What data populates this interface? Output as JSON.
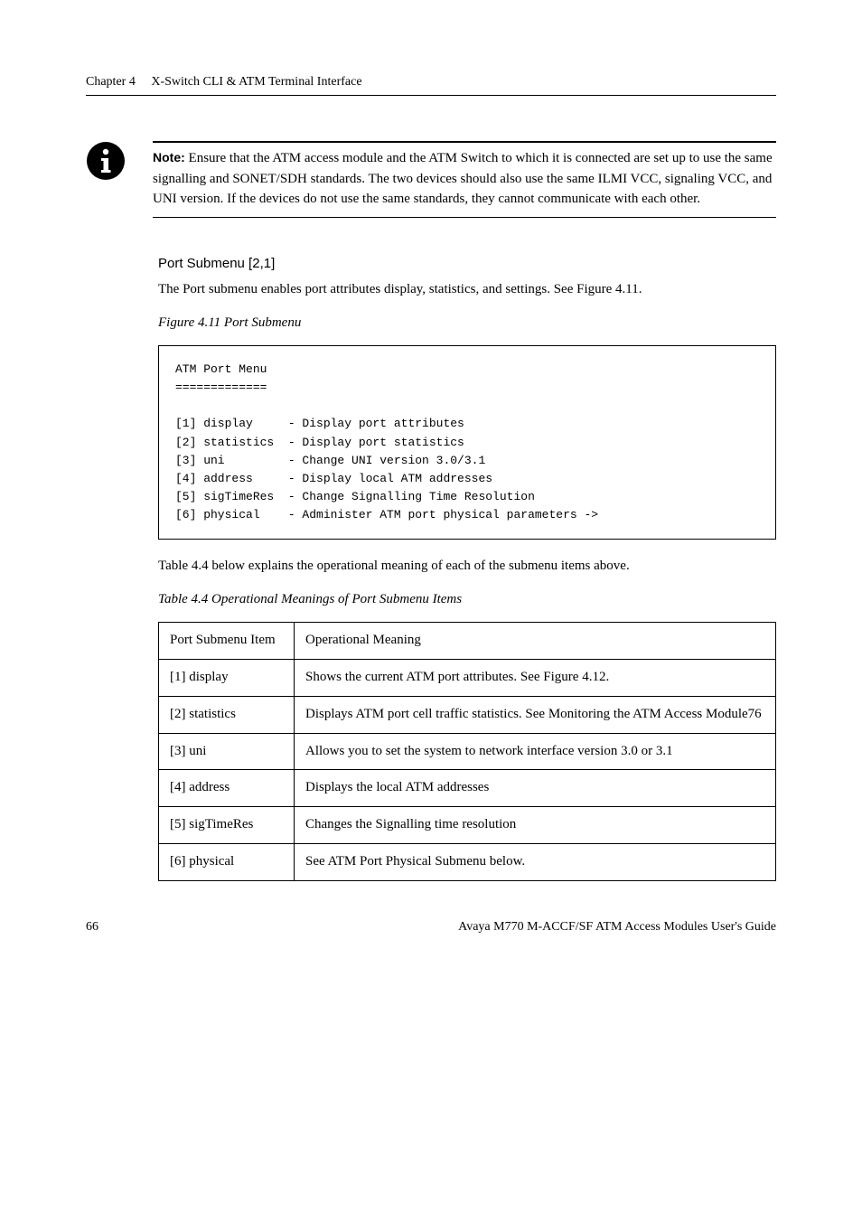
{
  "header": {
    "chapter": "Chapter 4",
    "title": "X-Switch CLI & ATM Terminal Interface"
  },
  "note": {
    "label": "Note:",
    "text": " Ensure that the ATM access module and the ATM Switch to which it is connected are set up to use the same signalling and SONET/SDH standards. The two devices should also use the same ILMI VCC, signaling VCC, and UNI version. If the devices do not use the same standards, they cannot communicate with each other."
  },
  "subsection": {
    "title": "Port Submenu [2,1]",
    "intro": "The Port submenu enables port attributes display, statistics, and settings. See Figure 4.11."
  },
  "figure": {
    "caption": "Figure 4.11    Port Submenu",
    "code": "ATM Port Menu\n=============\n\n[1] display     - Display port attributes\n[2] statistics  - Display port statistics\n[3] uni         - Change UNI version 3.0/3.1\n[4] address     - Display local ATM addresses\n[5] sigTimeRes  - Change Signalling Time Resolution\n[6] physical    - Administer ATM port physical parameters ->"
  },
  "tableIntro": "Table 4.4 below explains the operational meaning of each of the submenu items above.",
  "table": {
    "caption": "Table 4.4        Operational Meanings of Port Submenu Items",
    "headers": [
      "Port Submenu Item",
      "Operational Meaning"
    ],
    "rows": [
      [
        "[1] display",
        "Shows the current ATM port attributes. See Figure 4.12."
      ],
      [
        "[2] statistics",
        "Displays ATM port cell traffic statistics. See Monitoring the ATM Access Module76"
      ],
      [
        "[3] uni",
        "Allows you to set the system to network interface version 3.0 or 3.1"
      ],
      [
        "[4] address",
        "Displays the local ATM addresses"
      ],
      [
        "[5] sigTimeRes",
        "Changes the Signalling time resolution"
      ],
      [
        "[6] physical",
        "See ATM Port Physical Submenu below."
      ]
    ]
  },
  "footer": {
    "page": "66",
    "text": "Avaya M770 M-ACCF/SF ATM Access Modules User's Guide"
  }
}
